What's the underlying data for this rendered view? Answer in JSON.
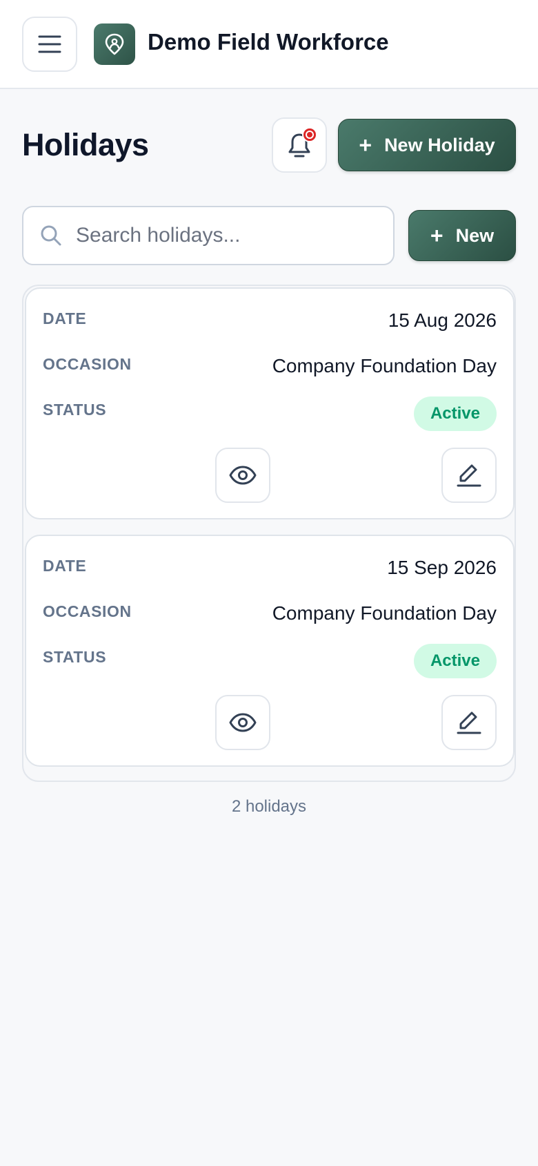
{
  "app": {
    "name": "Demo Field Workforce",
    "brand_color": "#3b675a"
  },
  "page": {
    "title": "Holidays",
    "new_holiday_label": "New Holiday",
    "new_label": "New"
  },
  "search": {
    "placeholder": "Search holidays...",
    "value": ""
  },
  "notifications": {
    "has_unread": true,
    "dot_color": "#dc2626"
  },
  "labels": {
    "date": "DATE",
    "occasion": "OCCASION",
    "status": "STATUS"
  },
  "holidays": [
    {
      "date": "15 Aug 2026",
      "occasion": "Company Foundation Day",
      "status": "Active"
    },
    {
      "date": "15 Sep 2026",
      "occasion": "Company Foundation Day",
      "status": "Active"
    }
  ],
  "footer": {
    "count_text": "2 holidays"
  },
  "icons": {
    "menu": "menu-icon",
    "logo": "location-pin-icon",
    "bell": "bell-icon",
    "plus": "plus-icon",
    "search": "search-icon",
    "view": "eye-icon",
    "edit": "pencil-icon"
  },
  "colors": {
    "status_active_bg": "#d1fae5",
    "status_active_text": "#059669"
  }
}
